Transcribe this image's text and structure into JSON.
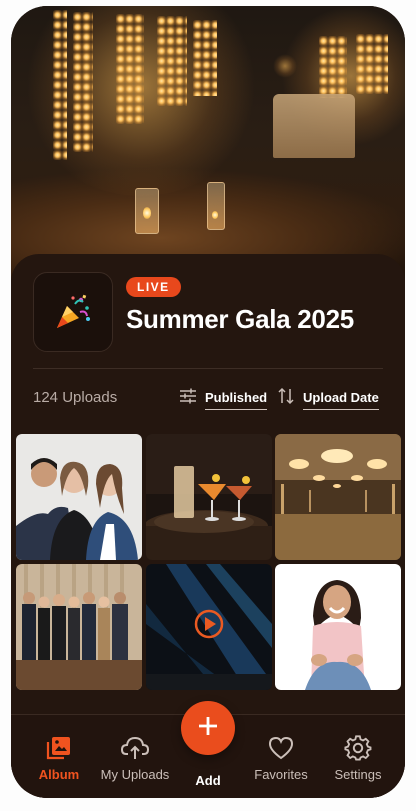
{
  "event": {
    "badge": "LIVE",
    "title": "Summer Gala 2025",
    "icon": "party-popper-icon"
  },
  "toolbar": {
    "upload_count": "124 Uploads",
    "filter_label": "Published",
    "sort_label": "Upload Date"
  },
  "gallery": [
    {
      "name": "team-photo",
      "kind": "photo"
    },
    {
      "name": "cocktails-photo",
      "kind": "photo"
    },
    {
      "name": "ballroom-photo",
      "kind": "photo"
    },
    {
      "name": "group-photo",
      "kind": "photo"
    },
    {
      "name": "stage-lights-video",
      "kind": "video"
    },
    {
      "name": "smiling-woman-photo",
      "kind": "photo"
    }
  ],
  "nav": {
    "album": "Album",
    "my_uploads": "My Uploads",
    "add": "Add",
    "favorites": "Favorites",
    "settings": "Settings",
    "active": "album"
  },
  "colors": {
    "accent": "#ea4d1d",
    "background": "#24160f"
  }
}
